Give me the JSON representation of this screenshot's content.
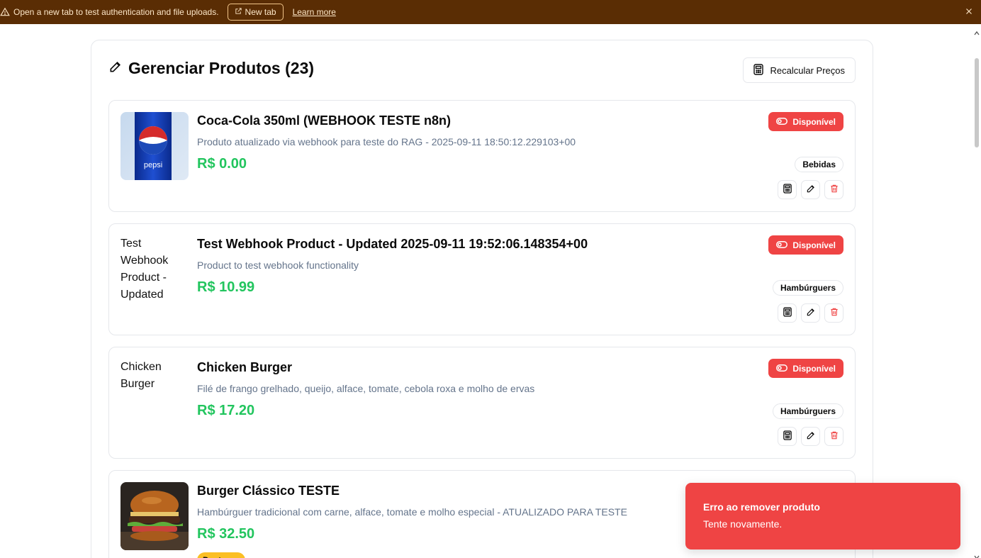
{
  "banner": {
    "message": "Open a new tab to test authentication and file uploads.",
    "new_tab_label": "New tab",
    "learn_more_label": "Learn more"
  },
  "panel": {
    "title": "Gerenciar Produtos (23)",
    "recalc_label": "Recalcular Preços"
  },
  "products": [
    {
      "name": "Coca-Cola 350ml (WEBHOOK TESTE n8n)",
      "description": "Produto atualizado via webhook para teste do RAG - 2025-09-11 18:50:12.229103+00",
      "price": "R$ 0.00",
      "status": "Disponível",
      "category": "Bebidas"
    },
    {
      "name": "Test Webhook Product - Updated 2025-09-11 19:52:06.148354+00",
      "description": "Product to test webhook functionality",
      "price": "R$ 10.99",
      "status": "Disponível",
      "category": "Hambúrguers",
      "image_alt": "Test Webhook Product - Updated"
    },
    {
      "name": "Chicken Burger",
      "description": "Filé de frango grelhado, queijo, alface, tomate, cebola roxa e molho de ervas",
      "price": "R$ 17.20",
      "status": "Disponível",
      "category": "Hambúrguers",
      "image_alt": "Chicken Burger"
    },
    {
      "name": "Burger Clássico TESTE",
      "description": "Hambúrguer tradicional com carne, alface, tomate e molho especial - ATUALIZADO PARA TESTE",
      "price": "R$ 32.50",
      "badge": "Destaque"
    }
  ],
  "toast": {
    "title": "Erro ao remover produto",
    "description": "Tente novamente."
  },
  "colors": {
    "banner_bg": "#5a2d04",
    "danger": "#ef4444",
    "price": "#22c55e",
    "muted": "#64748b",
    "featured": "#fbbf24"
  },
  "icons": [
    "warning-icon",
    "external-link-icon",
    "close-icon",
    "pencil-icon",
    "calculator-icon",
    "toggle-icon",
    "trash-icon"
  ]
}
